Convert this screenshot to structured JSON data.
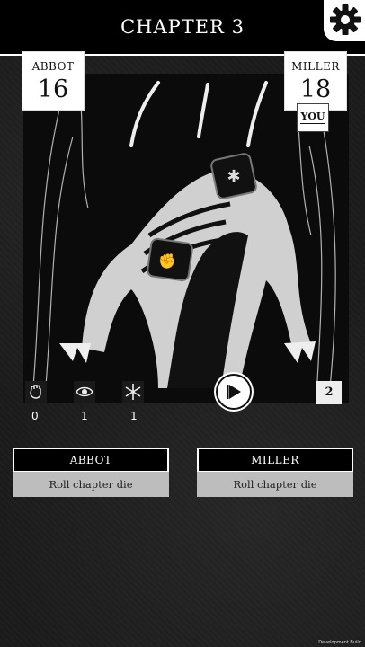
{
  "header": {
    "title": "CHAPTER 3"
  },
  "settings": {
    "icon": "gear-icon"
  },
  "players": [
    {
      "name": "ABBOT",
      "score": "16",
      "action": "Roll chapter die"
    },
    {
      "name": "MILLER",
      "score": "18",
      "action": "Roll chapter die",
      "badge": "YOU"
    }
  ],
  "dice_counts": [
    {
      "icon": "fist-icon",
      "count": "0"
    },
    {
      "icon": "eye-icon",
      "count": "1"
    },
    {
      "icon": "asterisk-icon",
      "count": "1"
    }
  ],
  "chapter_die": {
    "value": "2"
  },
  "play_icon": "play-icon",
  "footer": {
    "build": "Development Build"
  }
}
